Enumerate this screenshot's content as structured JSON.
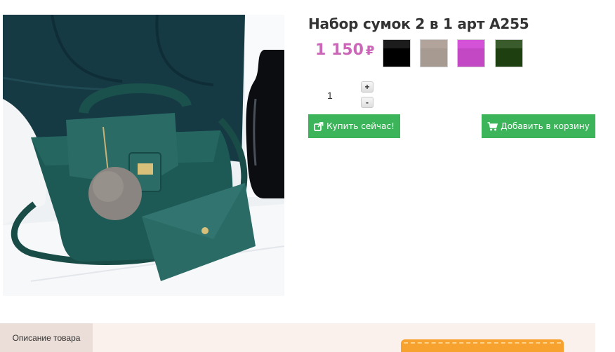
{
  "product": {
    "title": "Набор сумок 2 в 1 арт A255",
    "price": "1 150",
    "currency": "₽",
    "image_alt": "green-handbag-set-photo"
  },
  "color_options": [
    {
      "name": "black",
      "top": "#1c1c1c",
      "bottom": "#000000"
    },
    {
      "name": "taupe",
      "top": "#b2a49a",
      "bottom": "#a79a90"
    },
    {
      "name": "magenta",
      "top": "#d452d7",
      "bottom": "#c249c3"
    },
    {
      "name": "dark-green",
      "top": "#3a5c2c",
      "bottom": "#1e3f10"
    }
  ],
  "quantity": {
    "value": "1",
    "increment_label": "+",
    "decrement_label": "-"
  },
  "buttons": {
    "buy_now_label": "Купить сейчас!",
    "add_to_cart_label": "Добавить в корзину"
  },
  "tabs": {
    "description_label": "Описание товара"
  },
  "colors": {
    "accent_green": "#3cb55a",
    "price_pink": "#cc66b8",
    "tab_bg": "#faf0ec",
    "tab_active": "#ebddd7",
    "promo_orange": "#f7a22e"
  }
}
